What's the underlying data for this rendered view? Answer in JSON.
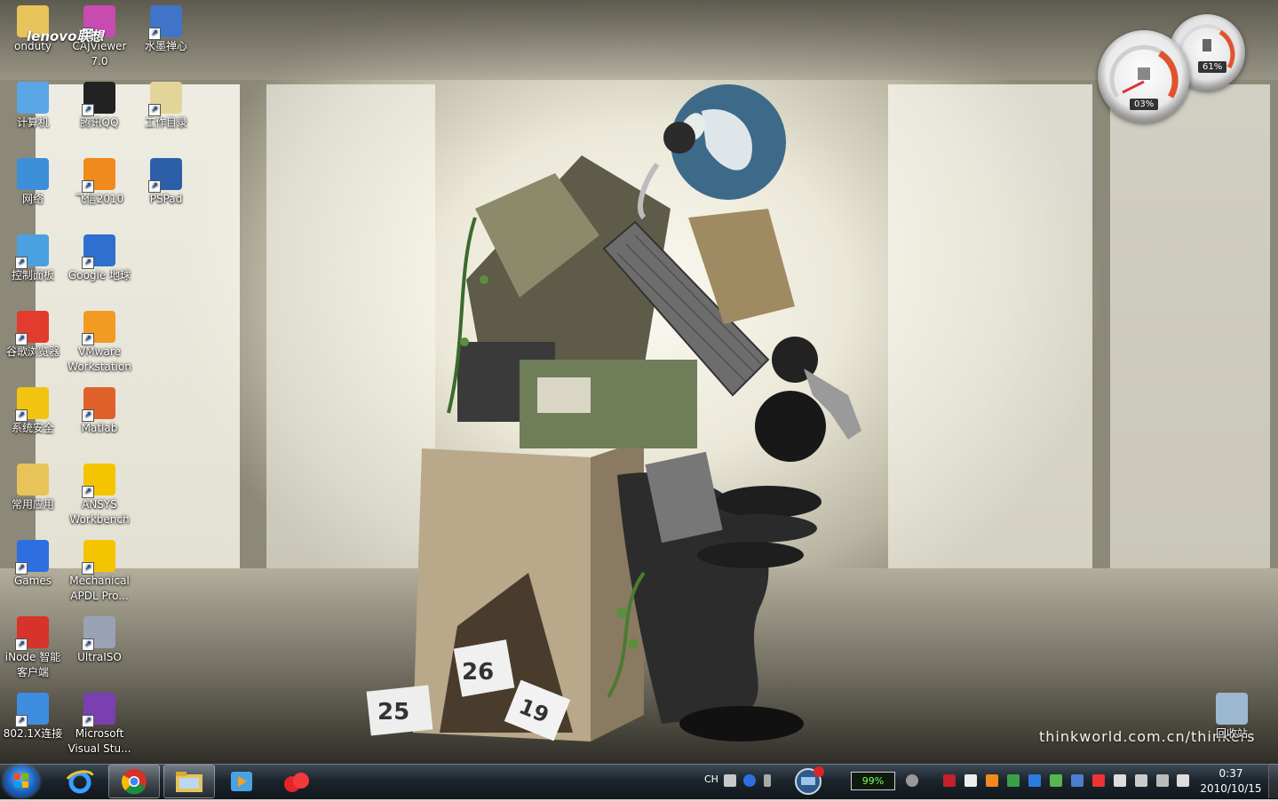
{
  "desktop": {
    "icons": [
      {
        "label": "onduty",
        "icon": "folder-icon",
        "color": "#e8c35a"
      },
      {
        "label": "CAJViewer 7.0",
        "icon": "cajviewer-icon",
        "color": "#c84bb0"
      },
      {
        "label": "水墨禅心",
        "icon": "theme-icon",
        "color": "#3f74c8"
      },
      {
        "label": "计算机",
        "icon": "computer-icon",
        "color": "#5aa6e6"
      },
      {
        "label": "腾讯QQ",
        "icon": "qq-icon",
        "color": "#222222"
      },
      {
        "label": "工作目录",
        "icon": "clipboard-icon",
        "color": "#e3d59a"
      },
      {
        "label": "网络",
        "icon": "network-icon",
        "color": "#3d8fd9"
      },
      {
        "label": "飞信2010",
        "icon": "fetion-icon",
        "color": "#f08a1c"
      },
      {
        "label": "PSPad",
        "icon": "pspad-icon",
        "color": "#2d5ea8"
      },
      {
        "label": "控制面板",
        "icon": "control-panel-icon",
        "color": "#4aa0e0"
      },
      {
        "label": "Google 地球",
        "icon": "google-earth-icon",
        "color": "#2e6fcf"
      },
      {
        "label": "谷歌浏览器",
        "icon": "chrome-icon",
        "color": "#e33b2e"
      },
      {
        "label": "VMware Workstation",
        "icon": "vmware-icon",
        "color": "#f29b22"
      },
      {
        "label": "系统安全",
        "icon": "security-shield-icon",
        "color": "#f1c40f"
      },
      {
        "label": "Matlab",
        "icon": "matlab-icon",
        "color": "#e0602a"
      },
      {
        "label": "常用应用",
        "icon": "folder-icon",
        "color": "#e8c35a"
      },
      {
        "label": "ANSYS Workbench",
        "icon": "ansys-icon",
        "color": "#f5c400"
      },
      {
        "label": "Games",
        "icon": "games-icon",
        "color": "#2d6fe0"
      },
      {
        "label": "Mechanical APDL Pro...",
        "icon": "ansys-mechanical-icon",
        "color": "#f5c400"
      },
      {
        "label": "iNode 智能客户端",
        "icon": "inode-icon",
        "color": "#d8332a"
      },
      {
        "label": "UltraISO",
        "icon": "disc-icon",
        "color": "#9aa3b5"
      },
      {
        "label": "802.1X连接",
        "icon": "network-shield-icon",
        "color": "#3f8de0"
      },
      {
        "label": "Microsoft Visual Stu...",
        "icon": "visual-studio-icon",
        "color": "#7a3fb0"
      },
      {
        "label": "回收站",
        "icon": "recycle-bin-icon",
        "color": "#9cb7d0"
      }
    ],
    "watermark": "thinkworld.com.cn/thinkers",
    "logo": "lenovo联想"
  },
  "gadget": {
    "cpu_percent": "03%",
    "memory_percent": "61%"
  },
  "taskbar": {
    "language": "CH",
    "battery": "99%",
    "time": "0:37",
    "date": "2010/10/15"
  }
}
